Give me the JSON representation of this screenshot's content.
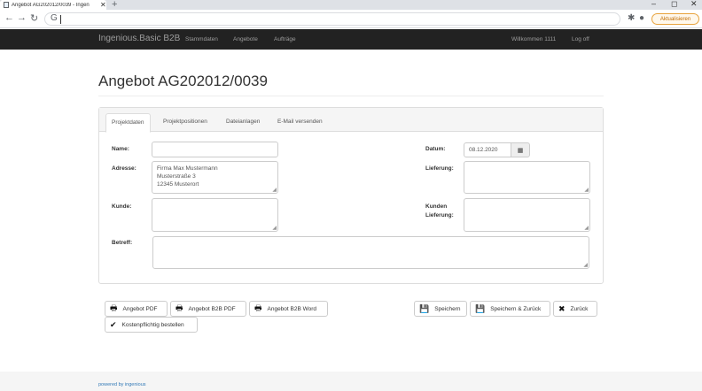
{
  "browser": {
    "tab_title": "Angebot AG202012/0039 - Ingen",
    "tab_close": "✕",
    "new_tab": "+",
    "update_label": "Aktualisieren",
    "window_controls": [
      "–",
      "◻",
      "✕"
    ]
  },
  "app": {
    "brand": "Ingenious.Basic B2B",
    "nav": [
      "Stammdaten",
      "Angebote",
      "Aufträge"
    ],
    "welcome": "Willkommen 1111",
    "logout": "Log off"
  },
  "page": {
    "title": "Angebot AG202012/0039"
  },
  "tabs": [
    "Projektdaten",
    "Projektpositionen",
    "Dateianlagen",
    "E-Mail versenden"
  ],
  "form": {
    "name_label": "Name:",
    "name_value": "",
    "address_label": "Adresse:",
    "address_lines": [
      "Firma Max Mustermann",
      "Musterstraße 3",
      "12345 Musterort"
    ],
    "customer_label": "Kunde:",
    "customer_value": "",
    "subject_label": "Betreff:",
    "subject_value": "",
    "date_label": "Datum:",
    "date_value": "08.12.2020",
    "delivery_label": "Lieferung:",
    "delivery_value": "",
    "customer_delivery_label_1": "Kunden",
    "customer_delivery_label_2": "Lieferung:",
    "customer_delivery_value": ""
  },
  "buttons": {
    "pdf": "Angebot PDF",
    "b2b_pdf": "Angebot B2B PDF",
    "b2b_word": "Angebot B2B Word",
    "order": "Kostenpflichtig bestellen",
    "save": "Speichern",
    "save_back": "Speichern & Zurück",
    "back": "Zurück"
  },
  "footer": {
    "powered_by": "powered by ingenious"
  }
}
